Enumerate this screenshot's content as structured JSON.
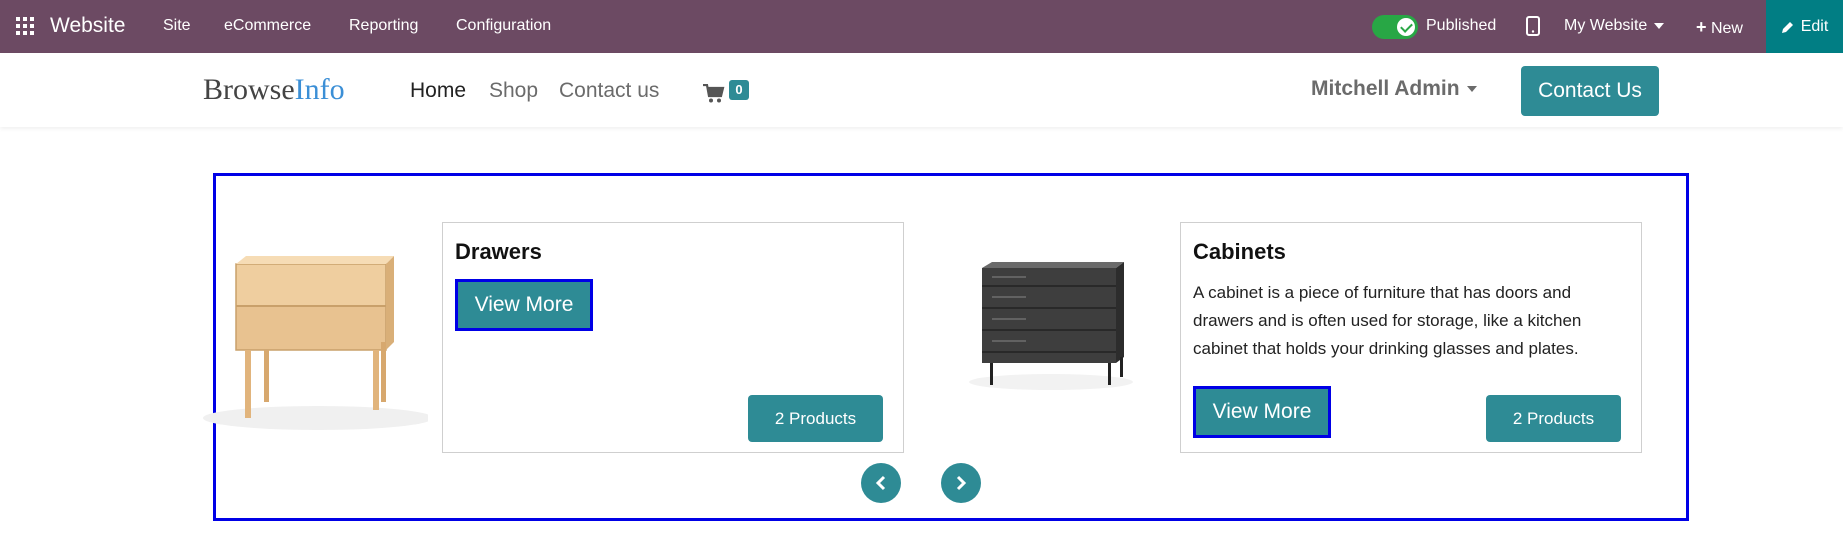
{
  "admin_bar": {
    "app_name": "Website",
    "menu": [
      "Site",
      "eCommerce",
      "Reporting",
      "Configuration"
    ],
    "published_label": "Published",
    "published": true,
    "website_selector": "My Website",
    "new_label": "New",
    "edit_label": "Edit",
    "colors": {
      "bar": "#6c4a63",
      "edit": "#017e84",
      "toggle": "#28a745"
    }
  },
  "header": {
    "logo_part1": "Browse",
    "logo_part2": "Info",
    "nav": [
      "Home",
      "Shop",
      "Contact us"
    ],
    "active_nav": "Home",
    "cart_count": "0",
    "user_name": "Mitchell Admin",
    "contact_button": "Contact Us",
    "colors": {
      "accent": "#2e8b95",
      "logo_accent": "#3b8fd6"
    }
  },
  "carousel": {
    "categories": [
      {
        "title": "Drawers",
        "description": "",
        "view_more_label": "View More",
        "products_label": "2 Products",
        "image_icon": "drawer-cabinet-image"
      },
      {
        "title": "Cabinets",
        "description": "A cabinet is a piece of furniture that has doors and drawers and is often used for storage, like a kitchen cabinet that holds your drinking glasses and plates.",
        "view_more_label": "View More",
        "products_label": "2 Products",
        "image_icon": "dresser-image"
      }
    ],
    "prev_icon": "chevron-left-icon",
    "next_icon": "chevron-right-icon",
    "highlight_color": "#0000e6"
  }
}
